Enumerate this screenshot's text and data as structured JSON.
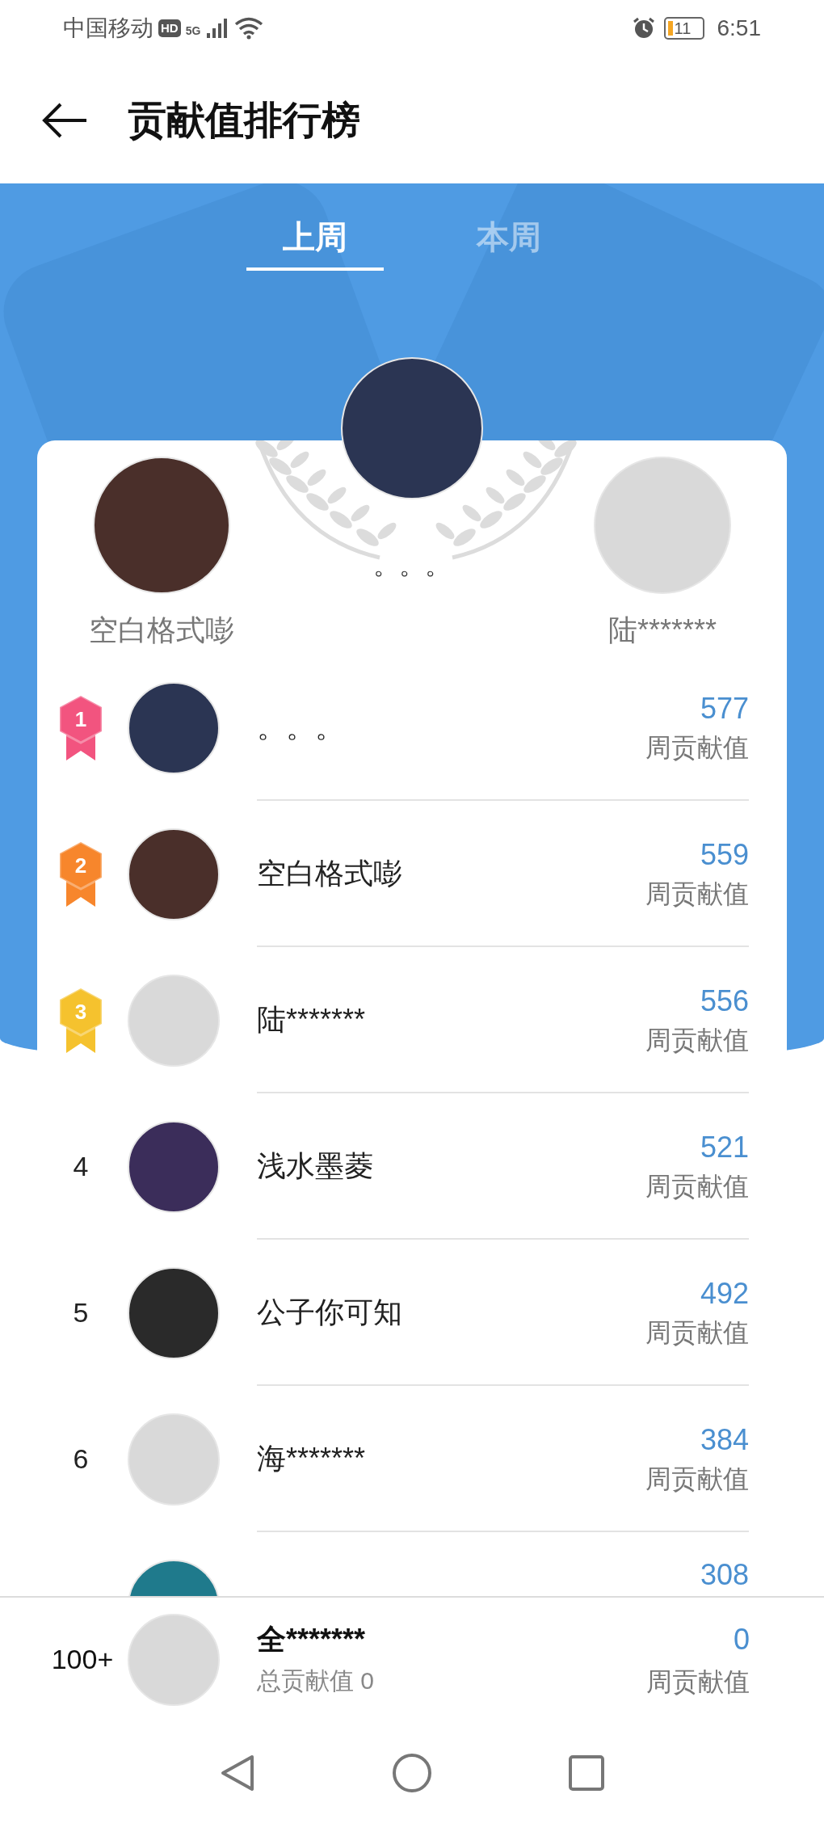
{
  "status_bar": {
    "carrier": "中国移动",
    "hd": "HD",
    "network": "5G",
    "battery": "11",
    "time": "6:51"
  },
  "header": {
    "title": "贡献值排行榜"
  },
  "tabs": [
    {
      "label": "上周",
      "selected": true
    },
    {
      "label": "本周",
      "selected": false
    }
  ],
  "podium": [
    {
      "kind": "first",
      "name": "。。。"
    },
    {
      "kind": "second",
      "name": "空白格式嘭"
    },
    {
      "kind": "third",
      "name": "陆*******"
    }
  ],
  "rows": [
    {
      "kind": "medal",
      "color": "#f2547f",
      "rank": "1",
      "name": "。。。",
      "score": "577",
      "score_label": "周贡献值"
    },
    {
      "kind": "medal",
      "color": "#f7862c",
      "rank": "2",
      "name": "空白格式嘭",
      "score": "559",
      "score_label": "周贡献值"
    },
    {
      "kind": "medal",
      "color": "#f5c22e",
      "rank": "3",
      "name": "陆*******",
      "score": "556",
      "score_label": "周贡献值"
    },
    {
      "kind": "plain",
      "rank": "4",
      "name": "浅水墨菱",
      "score": "521",
      "score_label": "周贡献值"
    },
    {
      "kind": "plain",
      "rank": "5",
      "name": "公子你可知",
      "score": "492",
      "score_label": "周贡献值"
    },
    {
      "kind": "plain",
      "rank": "6",
      "name": "海*******",
      "score": "384",
      "score_label": "周贡献值"
    },
    {
      "kind": "partial",
      "score": "308"
    }
  ],
  "footer": {
    "rank": "100+",
    "name": "全*******",
    "total": "总贡献值 0",
    "score": "0",
    "score_label": "周贡献值"
  }
}
